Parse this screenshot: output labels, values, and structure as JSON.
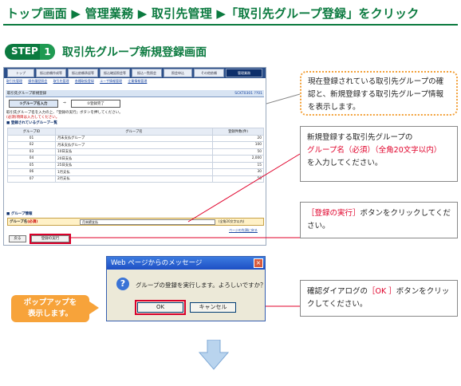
{
  "header": {
    "breadcrumb": "トップ画面 ▶ 管理業務 ▶ 取引先管理 ▶「取引先グループ登録」をクリック"
  },
  "step": {
    "label": "STEP",
    "number": "1",
    "title": "取引先グループ新規登録画面"
  },
  "screen": {
    "tabs": [
      "トップ",
      "振込依頼作成等",
      "振込依頼承認等",
      "振込確認照会等",
      "振込一覧照会",
      "照会申込",
      "その他依頼",
      "管理業務"
    ],
    "submenu": [
      "取引先管理",
      "操作履歴照会",
      "取引先管理",
      "各種取扱登録",
      "ユーザ情報管理",
      "企業情報管理"
    ],
    "panel_title": "取引先グループ新規登録",
    "panel_code": "SCKT0301 ??01",
    "steps": [
      "①グループ名入力",
      "②登録完了"
    ],
    "step_arrow": "⇒",
    "instruction1": "取引先グループ名を入力の上、「登録の実行」ボタンを押してください。",
    "instruction2": "(必須)項目は入力してください。",
    "list_title": "■ 登録されているグループ一覧",
    "table_headers": [
      "グループID",
      "グループ名",
      "登録件数(件)"
    ],
    "rows": [
      {
        "id": "01",
        "name": "月末支払グループ",
        "count": "20"
      },
      {
        "id": "02",
        "name": "月末支払グループ",
        "count": "100"
      },
      {
        "id": "03",
        "name": "10日支払",
        "count": "50"
      },
      {
        "id": "04",
        "name": "20日支払",
        "count": "2,000"
      },
      {
        "id": "05",
        "name": "25日支払",
        "count": "15"
      },
      {
        "id": "06",
        "name": "1月支払",
        "count": "30"
      },
      {
        "id": "07",
        "name": "2月支払",
        "count": "50"
      }
    ],
    "group_info_title": "■ グループ情報",
    "group_name_label": "グループ名",
    "required_mark": "(必須)",
    "group_name_value": "月末締支払",
    "group_hint": "(全角20文字以内)",
    "page_top_link": "ページの先頭に戻る",
    "back_button": "戻る",
    "execute_button": "登録の実行"
  },
  "dialog": {
    "title": "Web ページからのメッセージ",
    "close": "×",
    "icon": "?",
    "message": "グループの登録を実行します。よろしいですか？",
    "ok": "OK",
    "cancel": "キャンセル"
  },
  "callouts": {
    "top": "現在登録されている取引先グループの確認と、新規登録する取引先グループ情報を表示します。",
    "name_line1": "新規登録する取引先グループの",
    "name_red": "グループ名（必須）（全角20文字以内）",
    "name_line3": "を入力してください。",
    "exec_red": "［登録の実行］",
    "exec_rest": "ボタンをクリックしてください。",
    "ok_pre": "確認ダイアログの",
    "ok_red": "［OK ］",
    "ok_rest": "ボタンをクリックしてください。"
  },
  "popup_note": {
    "line1": "ポップアップを",
    "line2": "表示します。"
  },
  "colors": {
    "brand_green": "#0b7a3f",
    "accent_red": "#e0002a",
    "callout_orange": "#f7a33a"
  }
}
